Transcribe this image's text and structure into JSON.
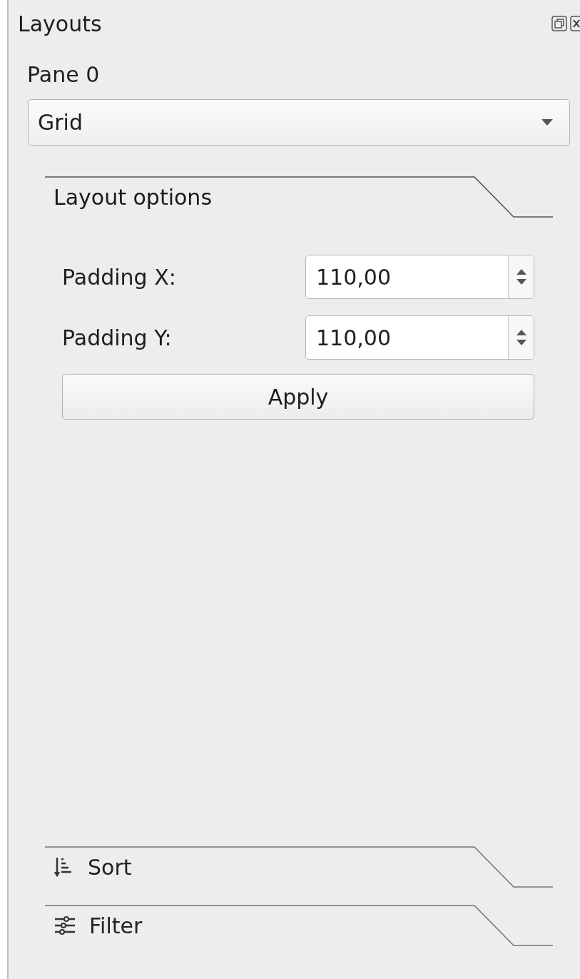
{
  "dock": {
    "title": "Layouts"
  },
  "pane": {
    "label": "Pane 0",
    "layout_select": {
      "value": "Grid"
    }
  },
  "sections": [
    {
      "kind": "layout",
      "label": "Layout options",
      "expanded": true,
      "fields": [
        {
          "label": "Padding X:",
          "value": "110,00"
        },
        {
          "label": "Padding Y:",
          "value": "110,00"
        }
      ],
      "button": "Apply"
    },
    {
      "kind": "sort",
      "label": "Sort",
      "expanded": false
    },
    {
      "kind": "filter",
      "label": "Filter",
      "expanded": false
    }
  ]
}
